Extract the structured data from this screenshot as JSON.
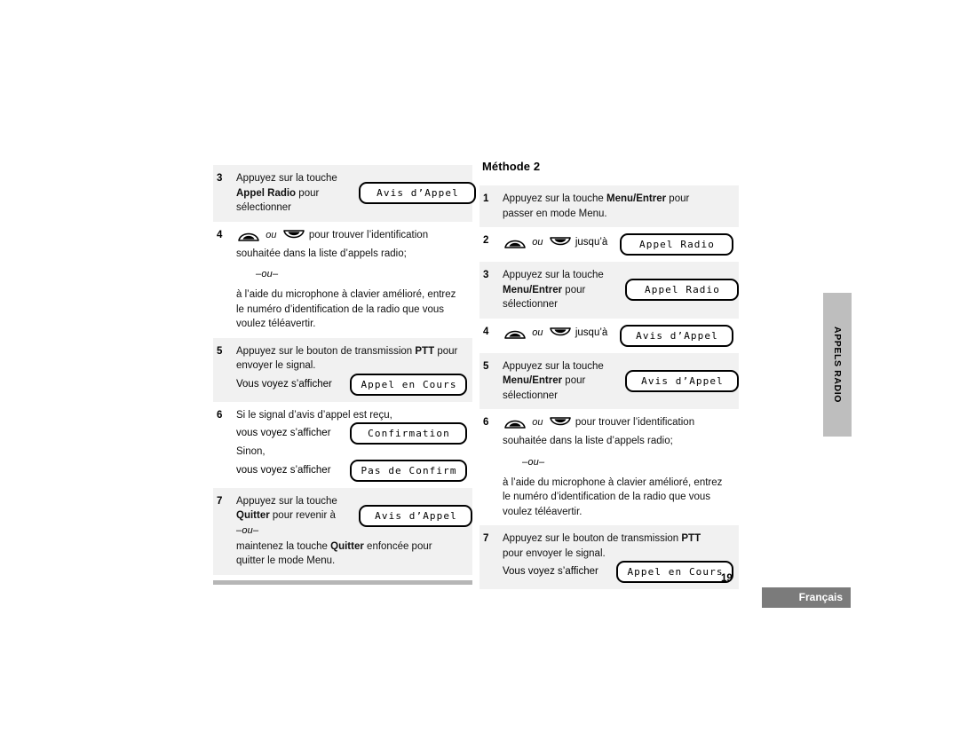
{
  "page": {
    "number": "19",
    "language_label": "Français",
    "side_tab": "APPELS RADIO"
  },
  "icons": {
    "up": "up-arrow-button-icon",
    "down": "down-arrow-button-icon"
  },
  "common": {
    "ou": "–ou–",
    "ou_italic": "ou",
    "press_key": "Appuyez sur la touche",
    "to_select": "sélectionner",
    "find_id_line1": "pour trouver l’identification",
    "find_id_line2": "souhaitée dans la liste d’appels radio;",
    "keypad_line1": "à l’aide du microphone à clavier amélioré, entrez",
    "keypad_line2": "le numéro d’identification de la radio que vous",
    "keypad_line3": "voulez téléavertir.",
    "you_see": "Vous voyez s’afficher",
    "until": "jusqu’à"
  },
  "left_column": {
    "steps": [
      {
        "num": "3",
        "shaded": true,
        "text_line1": "Appuyez sur la touche",
        "text_bold": "Appel Radio",
        "text_after_bold": "pour",
        "text_line3": "sélectionner",
        "lcd": "Avis d’Appel"
      },
      {
        "num": "4",
        "shaded": false,
        "icons_line_after": "pour trouver l’identification",
        "line2": "souhaitée dans la liste d’appels radio;",
        "ou": "–ou–",
        "alt_line1": "à l’aide du microphone à clavier amélioré, entrez",
        "alt_line2": "le numéro d’identification de la radio que vous",
        "alt_line3": "voulez téléavertir."
      },
      {
        "num": "5",
        "shaded": true,
        "line1_pre": "Appuyez sur le bouton de transmission",
        "line1_bold": "PTT",
        "line1_post": "pour",
        "line2": "envoyer le signal.",
        "row_label": "Vous voyez s’afficher",
        "lcd": "Appel en Cours"
      },
      {
        "num": "6",
        "shaded": false,
        "line1": "Si le signal d’avis d’appel est reçu,",
        "row1_label": "vous voyez s’afficher",
        "row1_lcd": "Confirmation",
        "line2": "Sinon,",
        "row2_label": "vous voyez s’afficher",
        "row2_lcd": "Pas de Confirm"
      },
      {
        "num": "7",
        "shaded": true,
        "text_line1": "Appuyez sur la touche",
        "text_bold": "Quitter",
        "text_after_bold": "pour revenir à",
        "lcd": "Avis d’Appel",
        "ou": "–ou–",
        "alt_line1_pre": "maintenez la touche",
        "alt_line1_bold": "Quitter",
        "alt_line1_post": "enfoncée pour",
        "alt_line2": "quitter le mode Menu."
      }
    ]
  },
  "right_column": {
    "title": "Méthode 2",
    "steps": [
      {
        "num": "1",
        "shaded": true,
        "line1_pre": "Appuyez sur la touche",
        "line1_bold": "Menu/Entrer",
        "line1_post": "pour",
        "line2": "passer en mode Menu."
      },
      {
        "num": "2",
        "shaded": false,
        "after_icons": "jusqu’à",
        "lcd": "Appel Radio"
      },
      {
        "num": "3",
        "shaded": true,
        "text_line1": "Appuyez sur la touche",
        "text_bold": "Menu/Entrer",
        "text_after_bold": "pour",
        "text_line3": "sélectionner",
        "lcd": "Appel Radio"
      },
      {
        "num": "4",
        "shaded": false,
        "after_icons": "jusqu’à",
        "lcd": "Avis d’Appel"
      },
      {
        "num": "5",
        "shaded": true,
        "text_line1": "Appuyez sur la touche",
        "text_bold": "Menu/Entrer",
        "text_after_bold": "pour",
        "text_line3": "sélectionner",
        "lcd": "Avis d’Appel"
      },
      {
        "num": "6",
        "shaded": false,
        "after_icons": "pour trouver l’identification",
        "line2": "souhaitée dans la liste d’appels radio;",
        "ou": "–ou–",
        "alt_line1": "à l’aide du microphone à clavier amélioré, entrez",
        "alt_line2": "le numéro d’identification de la radio que vous",
        "alt_line3": "voulez téléavertir."
      },
      {
        "num": "7",
        "shaded": true,
        "line1_pre": "Appuyez sur le bouton de transmission",
        "line1_bold": "PTT",
        "line2": "pour envoyer le signal.",
        "row_label": "Vous voyez s’afficher",
        "lcd": "Appel en Cours"
      }
    ]
  },
  "colors": {
    "shade": "#f1f1f1",
    "rule": "#b6b6b6",
    "tab": "#bebebe",
    "footer_box": "#7b7b7b"
  }
}
